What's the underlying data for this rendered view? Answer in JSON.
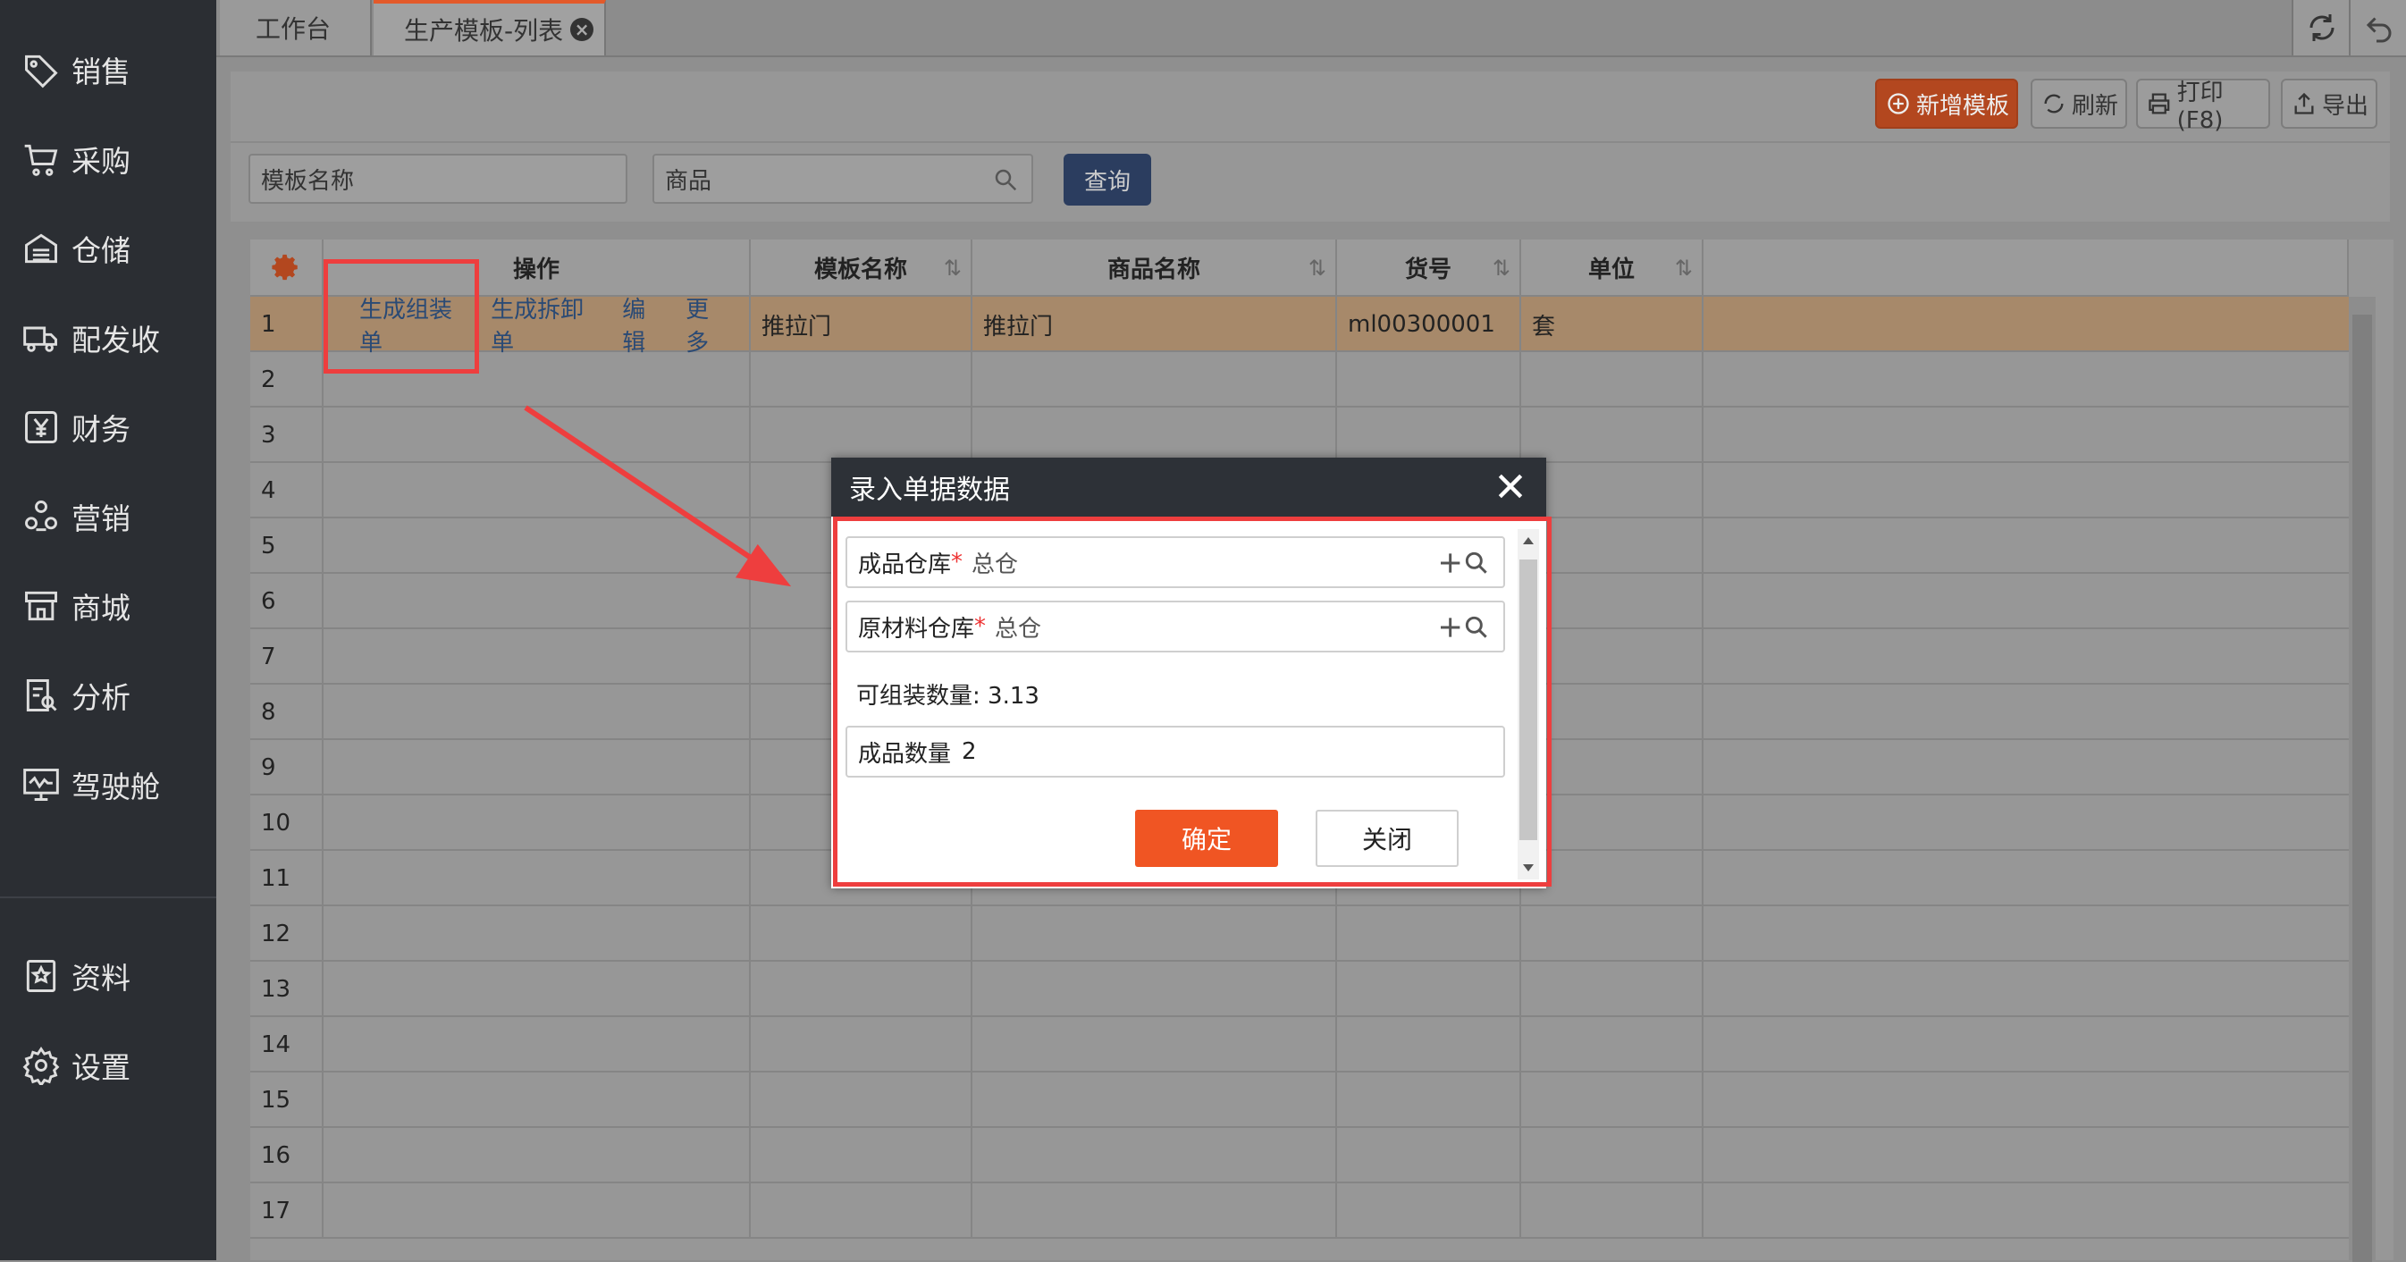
{
  "sidebar": {
    "items": [
      {
        "label": "销售",
        "icon": "tag-icon"
      },
      {
        "label": "采购",
        "icon": "cart-icon"
      },
      {
        "label": "仓储",
        "icon": "warehouse-icon"
      },
      {
        "label": "配发收",
        "icon": "truck-icon"
      },
      {
        "label": "财务",
        "icon": "yen-icon"
      },
      {
        "label": "营销",
        "icon": "marketing-icon"
      },
      {
        "label": "商城",
        "icon": "store-icon"
      },
      {
        "label": "分析",
        "icon": "analysis-icon"
      },
      {
        "label": "驾驶舱",
        "icon": "dashboard-icon"
      }
    ],
    "bottom_items": [
      {
        "label": "资料",
        "icon": "profile-icon"
      },
      {
        "label": "设置",
        "icon": "gear-icon"
      }
    ]
  },
  "tabs": [
    {
      "label": "工作台"
    },
    {
      "label": "生产模板-列表",
      "active": true
    }
  ],
  "toolbar": {
    "add_label": "新增模板",
    "refresh_label": "刷新",
    "print_label": "打印(F8)",
    "export_label": "导出"
  },
  "search": {
    "template_name": "模板名称",
    "product": "商品",
    "query_label": "查询"
  },
  "table": {
    "headers": {
      "op": "操作",
      "name": "模板名称",
      "product": "商品名称",
      "sku": "货号",
      "unit": "单位"
    },
    "row1": {
      "num": "1",
      "op_links": [
        "生成组装单",
        "生成拆卸单",
        "编辑",
        "更多"
      ],
      "name": "推拉门",
      "product": "推拉门",
      "sku": "ml00300001",
      "unit": "套"
    },
    "row_numbers": [
      "2",
      "3",
      "4",
      "5",
      "6",
      "7",
      "8",
      "9",
      "10",
      "11",
      "12",
      "13",
      "14",
      "15",
      "16",
      "17"
    ]
  },
  "modal": {
    "title": "录入单据数据",
    "finished_warehouse_label": "成品仓库",
    "finished_warehouse_value": "总仓",
    "raw_warehouse_label": "原材料仓库",
    "raw_warehouse_value": "总仓",
    "assemblable_text": "可组装数量: 3.13",
    "qty_label": "成品数量",
    "qty_value": "2",
    "required_mark": "*",
    "ok_label": "确定",
    "close_label": "关闭"
  },
  "colors": {
    "accent": "#f05523",
    "highlight_box": "#ee3e3e",
    "sidebar_bg": "#2b2e33"
  }
}
